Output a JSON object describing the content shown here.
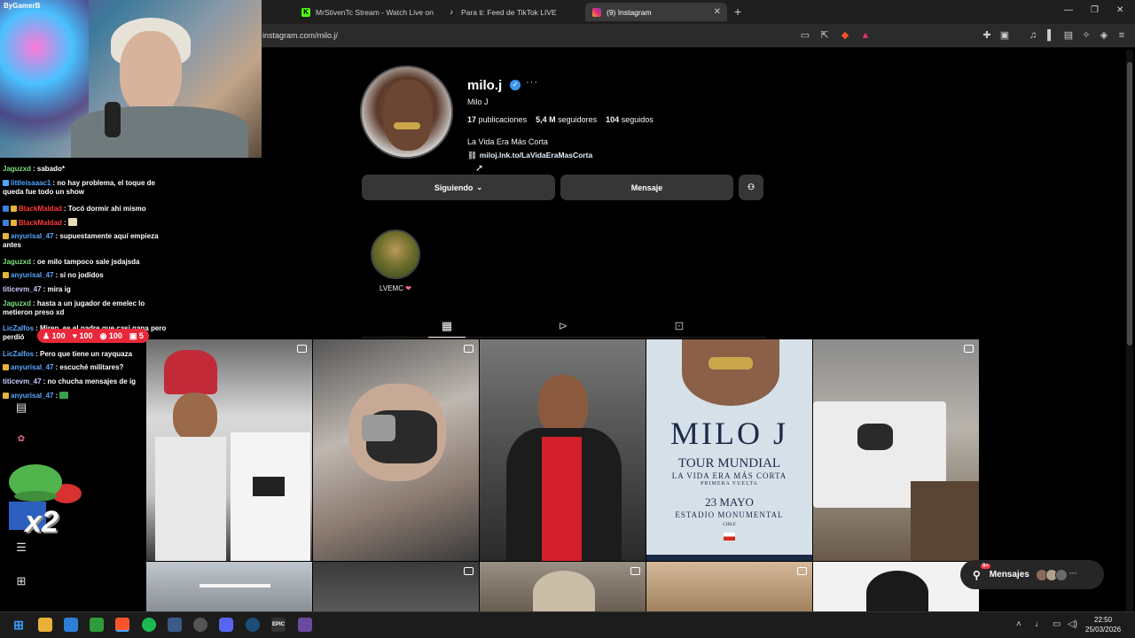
{
  "browser": {
    "tabs": [
      {
        "label": "MrStivenTc Stream - Watch Live on K",
        "favicon": "kick-icon",
        "color": "#53fc18"
      },
      {
        "label": "Para ti: Feed de TikTok LIVE",
        "favicon": "tiktok-icon",
        "color": "#ffffff"
      },
      {
        "label": "(9) Instagram",
        "favicon": "instagram-icon",
        "color": "#e1306c"
      }
    ],
    "url": "instagram.com/milo.j/"
  },
  "stream": {
    "webcam_tag": "ByGamerB",
    "chat": [
      {
        "user": "Jaguzxd",
        "user_color": "#7de07d",
        "text": "sabado*"
      },
      {
        "user": "littleisaaac1",
        "user_color": "#4fa3ff",
        "text": "no hay problema, el toque de queda fue todo un show"
      },
      {
        "user": "BlackMaldad",
        "user_color": "#ff3a3a",
        "text": "Tocó dormir ahí mismo"
      },
      {
        "user": "BlackMaldad",
        "user_color": "#ff3a3a",
        "text": ""
      },
      {
        "user": "anyurisal_47",
        "user_color": "#5aa9ff",
        "text": "supuestamente aquí empieza antes"
      },
      {
        "user": "Jaguzxd",
        "user_color": "#7de07d",
        "text": "oe milo tampoco sale jsdajsda"
      },
      {
        "user": "anyurisal_47",
        "user_color": "#5aa9ff",
        "text": "si no jodidos"
      },
      {
        "user": "titicevm_47",
        "user_color": "#c9c9ff",
        "text": "mira ig"
      },
      {
        "user": "Jaguzxd",
        "user_color": "#7de07d",
        "text": "hasta a un jugador de emelec lo metieron preso xd"
      },
      {
        "user": "LicZalfos",
        "user_color": "#5aa9ff",
        "text": "Miren, es el padre que casi gana pero perdió"
      },
      {
        "user": "LicZalfos",
        "user_color": "#5aa9ff",
        "text": "Pero que tiene un rayquaza"
      },
      {
        "user": "anyurisal_47",
        "user_color": "#5aa9ff",
        "text": "escuché militares?"
      },
      {
        "user": "titicevm_47",
        "user_color": "#c9c9ff",
        "text": "no chucha mensajes de ig"
      },
      {
        "user": "anyurisal_47",
        "user_color": "#5aa9ff",
        "text": ""
      }
    ],
    "alert": {
      "items": [
        "100",
        "100",
        "100",
        "5"
      ]
    },
    "emote_text": "x2"
  },
  "profile": {
    "username": "milo.j",
    "full_name": "Milo J",
    "posts_count": "17",
    "posts_label": "publicaciones",
    "followers_count": "5,4 M",
    "followers_label": "seguidores",
    "following_count": "104",
    "following_label": "seguidos",
    "bio": "La Vida Era Más Corta",
    "link": "miloj.lnk.to/LaVidaEraMasCorta",
    "following_button": "Siguiendo",
    "message_button": "Mensaje",
    "highlight_label": "LVEMC",
    "highlight_heart": "❤",
    "poster": {
      "title": "MILO J",
      "line1": "TOUR MUNDIAL",
      "line2": "LA VIDA ERA MÁS CORTA",
      "line3": "PRIMERA VUELTA",
      "date": "23 MAYO",
      "venue": "ESTADIO MONUMENTAL",
      "country": "CHILE"
    }
  },
  "messages_pill": {
    "label": "Mensajes",
    "badge": "9+"
  },
  "taskbar": {
    "time": "22:50",
    "date": "25/03/2026"
  }
}
